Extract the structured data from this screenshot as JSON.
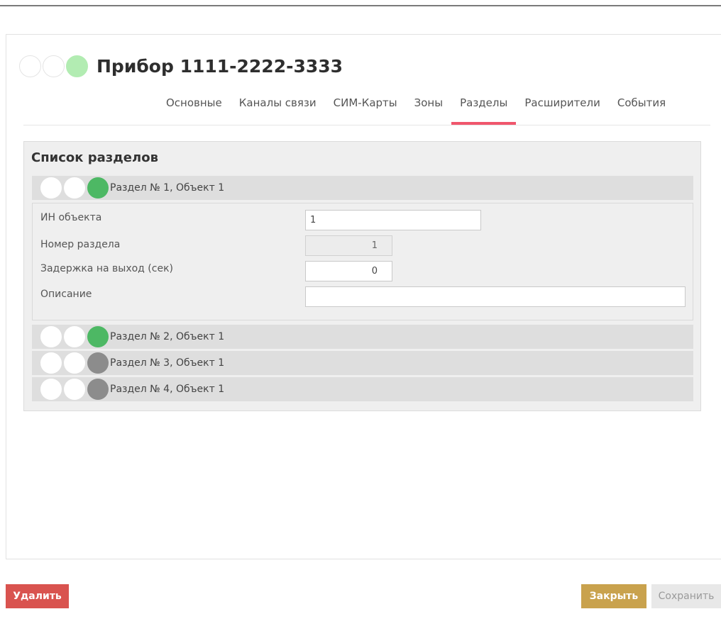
{
  "device": {
    "title": "Прибор 1111-2222-3333",
    "status_dots": [
      "inactive",
      "inactive",
      "active"
    ],
    "active_color": "#b2ecb2"
  },
  "tabs": [
    {
      "label": "Основные",
      "active": false
    },
    {
      "label": "Каналы связи",
      "active": false
    },
    {
      "label": "СИМ-Карты",
      "active": false
    },
    {
      "label": "Зоны",
      "active": false
    },
    {
      "label": "Разделы",
      "active": true
    },
    {
      "label": "Расширители",
      "active": false
    },
    {
      "label": "События",
      "active": false
    }
  ],
  "tab_accent_color": "#f0566c",
  "sections_panel": {
    "title": "Список разделов",
    "sections": [
      {
        "label": "Раздел № 1, Объект 1",
        "status": "on",
        "expanded": true
      },
      {
        "label": "Раздел № 2, Объект 1",
        "status": "on",
        "expanded": false
      },
      {
        "label": "Раздел № 3, Объект 1",
        "status": "off",
        "expanded": false
      },
      {
        "label": "Раздел № 4, Объект 1",
        "status": "off",
        "expanded": false
      }
    ],
    "status_colors": {
      "on": "#4db864",
      "off": "#8c8c8c"
    },
    "details": {
      "object_id": {
        "label": "ИН объекта",
        "value": "1"
      },
      "section_number": {
        "label": "Номер раздела",
        "value": "1"
      },
      "exit_delay": {
        "label": "Задержка на выход (сек)",
        "value": "0"
      },
      "description": {
        "label": "Описание",
        "value": ""
      }
    }
  },
  "footer": {
    "delete_label": "Удалить",
    "close_label": "Закрыть",
    "save_label": "Сохранить",
    "delete_color": "#d9534f",
    "close_color": "#c9a24d"
  }
}
